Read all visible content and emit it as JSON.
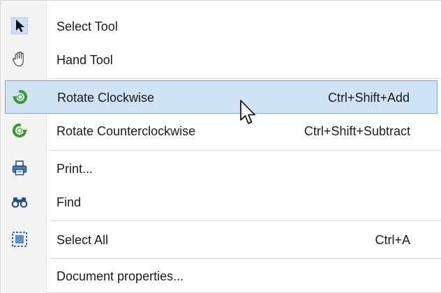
{
  "context_menu": {
    "items": [
      {
        "label": "Select Tool",
        "shortcut": "",
        "icon": "arrow-pointer-icon"
      },
      {
        "label": "Hand Tool",
        "shortcut": "",
        "icon": "hand-icon"
      },
      {
        "label": "Rotate Clockwise",
        "shortcut": "Ctrl+Shift+Add",
        "icon": "rotate-clockwise-icon"
      },
      {
        "label": "Rotate Counterclockwise",
        "shortcut": "Ctrl+Shift+Subtract",
        "icon": "rotate-counterclockwise-icon"
      },
      {
        "label": "Print...",
        "shortcut": "",
        "icon": "printer-icon"
      },
      {
        "label": "Find",
        "shortcut": "",
        "icon": "binoculars-icon"
      },
      {
        "label": "Select All",
        "shortcut": "Ctrl+A",
        "icon": "select-all-icon"
      },
      {
        "label": "Document properties...",
        "shortcut": "",
        "icon": ""
      }
    ],
    "hovered_item": "Rotate Clockwise",
    "colors": {
      "hover_background": "#cfe3f5",
      "hover_border": "#77a9d8",
      "icon_column": "#f3f3f3",
      "rotate_icon_green": "#3a9a2e",
      "text": "#1a1a1a"
    }
  }
}
